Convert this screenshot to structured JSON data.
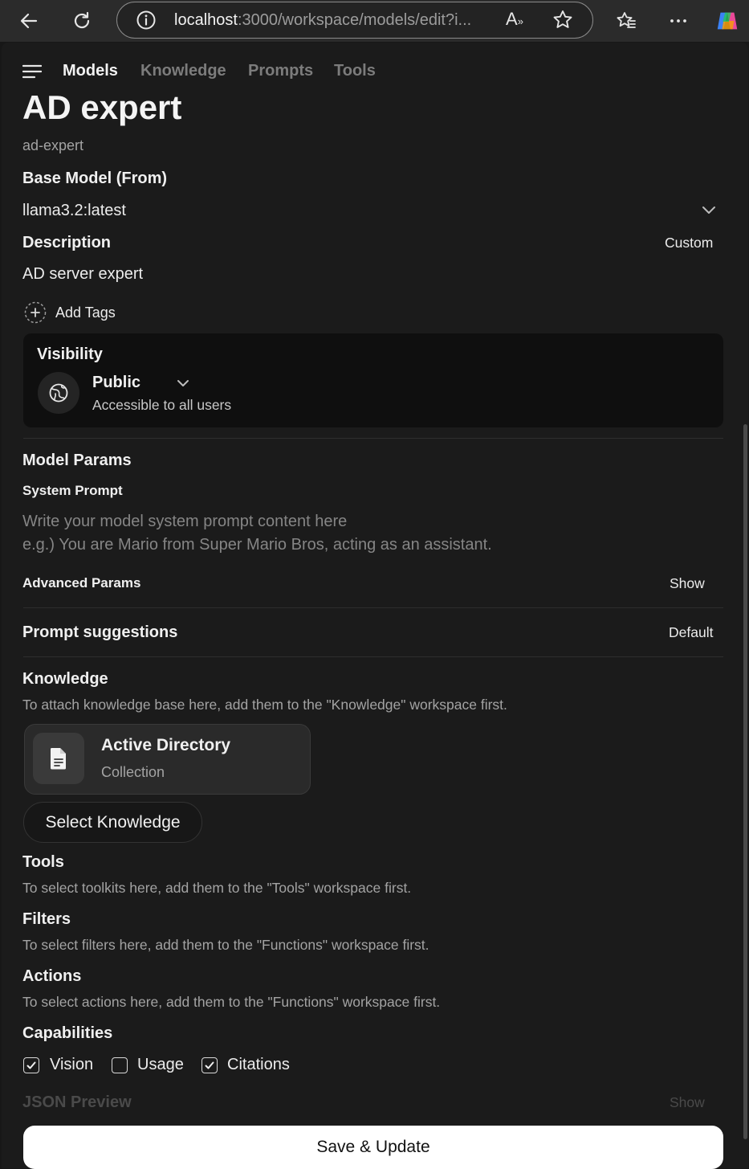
{
  "browser": {
    "url_host": "localhost",
    "url_rest": ":3000/workspace/models/edit?i..."
  },
  "nav": {
    "tabs": [
      {
        "label": "Models"
      },
      {
        "label": "Knowledge"
      },
      {
        "label": "Prompts"
      },
      {
        "label": "Tools"
      }
    ]
  },
  "model": {
    "name": "AD expert",
    "id": "ad-expert"
  },
  "base_model": {
    "label": "Base Model (From)",
    "value": "llama3.2:latest"
  },
  "description": {
    "label": "Description",
    "mode": "Custom",
    "value": "AD server expert"
  },
  "tags": {
    "add_label": "Add Tags"
  },
  "visibility": {
    "label": "Visibility",
    "value": "Public",
    "description": "Accessible to all users"
  },
  "model_params": {
    "label": "Model Params",
    "system_prompt_label": "System Prompt",
    "system_prompt_placeholder_1": "Write your model system prompt content here",
    "system_prompt_placeholder_2": "e.g.) You are Mario from Super Mario Bros, acting as an assistant.",
    "advanced_label": "Advanced Params",
    "advanced_toggle": "Show"
  },
  "prompt_suggestions": {
    "label": "Prompt suggestions",
    "mode": "Default"
  },
  "knowledge": {
    "label": "Knowledge",
    "help": "To attach knowledge base here, add them to the \"Knowledge\" workspace first.",
    "items": [
      {
        "name": "Active Directory",
        "type": "Collection"
      }
    ],
    "select_label": "Select Knowledge"
  },
  "tools": {
    "label": "Tools",
    "help": "To select toolkits here, add them to the \"Tools\" workspace first."
  },
  "filters": {
    "label": "Filters",
    "help": "To select filters here, add them to the \"Functions\" workspace first."
  },
  "actions": {
    "label": "Actions",
    "help": "To select actions here, add them to the \"Functions\" workspace first."
  },
  "capabilities": {
    "label": "Capabilities",
    "items": [
      {
        "label": "Vision",
        "checked": true
      },
      {
        "label": "Usage",
        "checked": false
      },
      {
        "label": "Citations",
        "checked": true
      }
    ]
  },
  "json_preview": {
    "label": "JSON Preview",
    "toggle": "Show"
  },
  "save_button": {
    "label": "Save & Update"
  }
}
